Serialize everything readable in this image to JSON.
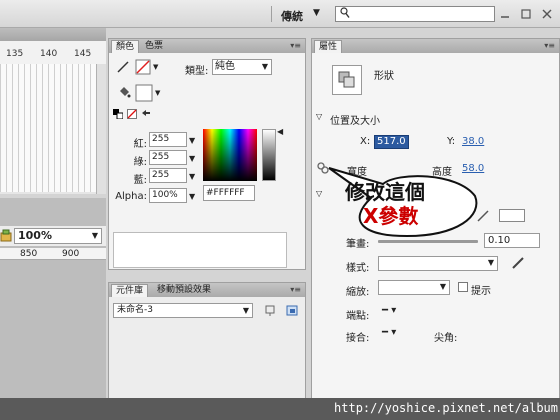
{
  "topbar": {
    "workspace": "傳統",
    "search_placeholder": ""
  },
  "timeline": {
    "frame_numbers": [
      "135",
      "140",
      "145"
    ]
  },
  "stage": {
    "zoom": "100%",
    "ruler": [
      "850",
      "900"
    ]
  },
  "color_panel": {
    "tabs": [
      "顏色",
      "色票"
    ],
    "type_label": "類型:",
    "type_value": "純色",
    "red_label": "紅:",
    "red": "255",
    "green_label": "綠:",
    "green": "255",
    "blue_label": "藍:",
    "blue": "255",
    "alpha_label": "Alpha:",
    "alpha": "100%",
    "hex": "#FFFFFF"
  },
  "library_panel": {
    "tabs": [
      "元件庫",
      "移動預設效果"
    ],
    "document": "未命名-3"
  },
  "properties_panel": {
    "tab": "屬性",
    "shape_label": "形狀",
    "section_title": "位置及大小",
    "x_label": "X:",
    "x_value": "517.0",
    "y_label": "Y:",
    "y_value": "38.0",
    "w_label": "寬度",
    "h_label": "高度",
    "h_value": "58.0",
    "stroke_label": "筆畫:",
    "stroke_value": "0.10",
    "style_label": "樣式:",
    "scale_label": "縮放:",
    "hint_label": "提示",
    "cap_label": "端點:",
    "join_label": "接合:",
    "miter_label": "尖角:"
  },
  "callout": {
    "line1": "修改這個",
    "line2": "X參數"
  },
  "footer": {
    "url": "http://yoshice.pixnet.net/album"
  }
}
